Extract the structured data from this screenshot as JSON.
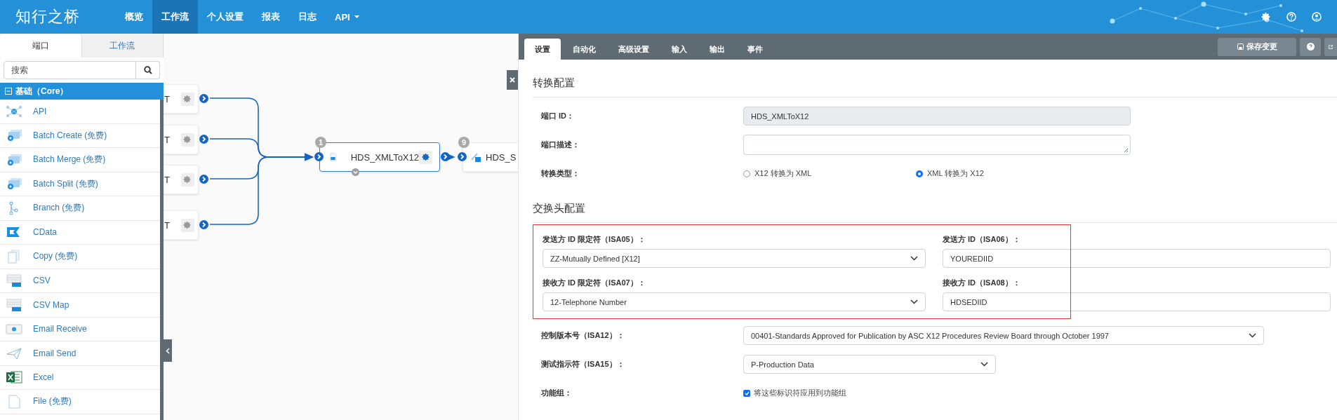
{
  "nav": {
    "logo": "知行之桥",
    "items": [
      {
        "label": "概览",
        "selected": false,
        "dropdown": false
      },
      {
        "label": "工作流",
        "selected": true,
        "dropdown": false
      },
      {
        "label": "个人设置",
        "selected": false,
        "dropdown": false
      },
      {
        "label": "报表",
        "selected": false,
        "dropdown": false
      },
      {
        "label": "日志",
        "selected": false,
        "dropdown": false
      },
      {
        "label": "API",
        "selected": false,
        "dropdown": true
      }
    ]
  },
  "sidebar": {
    "tabs": [
      {
        "label": "端口",
        "selected": true
      },
      {
        "label": "工作流",
        "selected": false
      }
    ],
    "search": {
      "placeholder": "搜索"
    },
    "category": {
      "label": "基础（Core）",
      "expanded": true
    },
    "items": [
      {
        "label": "API"
      },
      {
        "label": "Batch Create (免费)"
      },
      {
        "label": "Batch Merge (免费)"
      },
      {
        "label": "Batch Split (免费)"
      },
      {
        "label": "Branch (免费)"
      },
      {
        "label": "CData"
      },
      {
        "label": "Copy (免费)"
      },
      {
        "label": "CSV"
      },
      {
        "label": "CSV Map"
      },
      {
        "label": "Email Receive"
      },
      {
        "label": "Email Send"
      },
      {
        "label": "Excel"
      },
      {
        "label": "File (免费)"
      }
    ]
  },
  "canvas": {
    "sources": [
      {
        "label": "T"
      },
      {
        "label": "T"
      },
      {
        "label": "T"
      },
      {
        "label": "T"
      }
    ],
    "main": {
      "badge": "1",
      "label": "HDS_XMLToX12",
      "selected": true
    },
    "next": {
      "badge": "9",
      "label": "HDS_S"
    }
  },
  "panel": {
    "tabs": [
      {
        "label": "设置",
        "selected": true
      },
      {
        "label": "自动化",
        "selected": false
      },
      {
        "label": "高级设置",
        "selected": false
      },
      {
        "label": "输入",
        "selected": false
      },
      {
        "label": "输出",
        "selected": false
      },
      {
        "label": "事件",
        "selected": false
      }
    ],
    "save_button": "保存变更",
    "conversion": {
      "title": "转换配置",
      "rows": [
        {
          "kind": "readonly",
          "label": "端口 ID：",
          "value": "HDS_XMLToX12"
        },
        {
          "kind": "textarea",
          "label": "端口描述："
        },
        {
          "kind": "radio",
          "label": "转换类型：",
          "options": [
            {
              "label": "X12 转换为 XML",
              "selected": false
            },
            {
              "label": "XML 转换为 X12",
              "selected": true
            }
          ]
        }
      ]
    },
    "interchange": {
      "title": "交换头配置",
      "highlighted": true,
      "fields": [
        {
          "kind": "select",
          "label": "发送方 ID 限定符（ISA05）：",
          "value": "ZZ-Mutually Defined [X12]"
        },
        {
          "kind": "text",
          "label": "发送方 ID（ISA06）：",
          "value": "YOUREDIID"
        },
        {
          "kind": "select",
          "label": "接收方 ID 限定符（ISA07）：",
          "value": "12-Telephone Number"
        },
        {
          "kind": "text",
          "label": "接收方 ID（ISA08）：",
          "value": "HDSEDIID"
        }
      ],
      "rows": [
        {
          "kind": "select",
          "label": "控制版本号（ISA12）：",
          "value": "00401-Standards Approved for Publication by ASC X12 Procedures Review Board through October 1997",
          "wide": true
        },
        {
          "kind": "select",
          "label": "测试指示符（ISA15）：",
          "value": "P-Production Data",
          "wide": false
        },
        {
          "kind": "checkbox",
          "label": "功能组：",
          "option": "将这些标识符应用到功能组",
          "checked": true
        }
      ]
    }
  }
}
